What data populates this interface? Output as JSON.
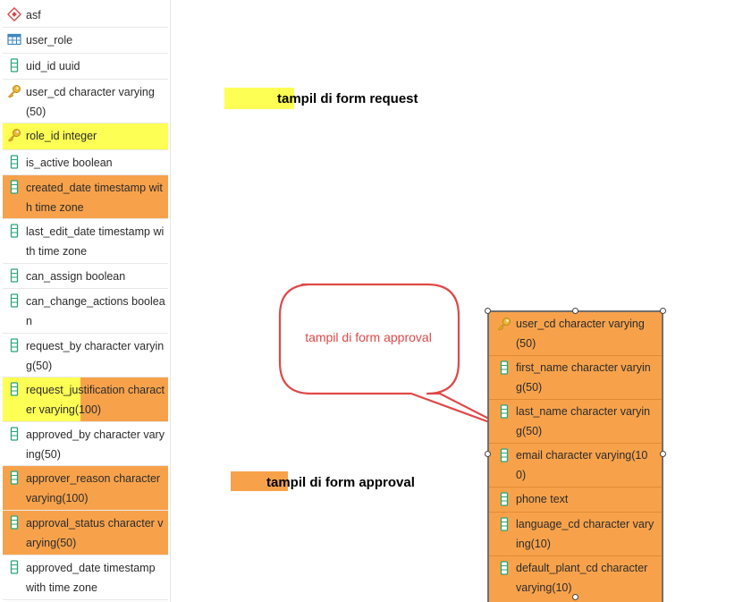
{
  "left_list": {
    "rows": [
      {
        "icon": "schema-icon",
        "text": "asf"
      },
      {
        "icon": "table-icon",
        "text": "user_role"
      },
      {
        "icon": "column-icon",
        "text": "uid_id uuid"
      },
      {
        "icon": "key-icon",
        "text": "user_cd character varying (50)"
      },
      {
        "icon": "key-icon",
        "text": "role_id integer"
      },
      {
        "icon": "column-icon",
        "text": "is_active boolean"
      },
      {
        "icon": "column-icon",
        "text": "created_date timestamp with time zone"
      },
      {
        "icon": "column-icon",
        "text": "last_edit_date timestamp with time zone"
      },
      {
        "icon": "column-icon",
        "text": "can_assign boolean"
      },
      {
        "icon": "column-icon",
        "text": "can_change_actions boolean"
      },
      {
        "icon": "column-icon",
        "text": "request_by character varying(50)"
      },
      {
        "icon": "column-icon",
        "text": "request_justification character varying(100)"
      },
      {
        "icon": "column-icon",
        "text": "approved_by character varying(50)"
      },
      {
        "icon": "column-icon",
        "text": "approver_reason character varying(100)"
      },
      {
        "icon": "column-icon",
        "text": "approval_status character varying(50)"
      },
      {
        "icon": "column-icon",
        "text": "approved_date timestamp with time zone"
      }
    ]
  },
  "right_panel": {
    "rows": [
      {
        "icon": "key-icon",
        "text": "user_cd character varying (50)"
      },
      {
        "icon": "column-icon",
        "text": "first_name character varying(50)"
      },
      {
        "icon": "column-icon",
        "text": "last_name character varying(50)"
      },
      {
        "icon": "column-icon",
        "text": "email character varying(100)"
      },
      {
        "icon": "column-icon",
        "text": "phone text"
      },
      {
        "icon": "column-icon",
        "text": "language_cd character varying(10)"
      },
      {
        "icon": "column-icon",
        "text": "default_plant_cd character varying(10)"
      }
    ]
  },
  "labels": {
    "request": "tampil di form request",
    "approval": "tampil di form approval",
    "callout": "tampil di form approval"
  },
  "colors": {
    "orange": "#f7a24b",
    "yellow": "#feff54",
    "callout_stroke": "#e04848"
  }
}
